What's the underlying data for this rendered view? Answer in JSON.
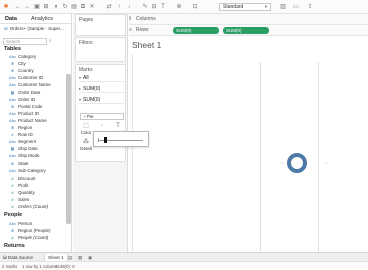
{
  "toolbar": {
    "icons": [
      "tableau-logo-icon",
      "back-icon",
      "forward-icon",
      "save-icon",
      "new-datasource-icon",
      "pause-icon",
      "refresh-icon",
      "new-sheet-icon",
      "duplicate-icon",
      "clear-icon",
      "swap-icon",
      "sort-asc-icon",
      "sort-desc-icon",
      "highlight-icon",
      "group-icon",
      "label-icon",
      "fix-axes-icon",
      "fit-icon",
      "show-cards-icon",
      "presentation-icon",
      "share-icon"
    ],
    "fit_value": "Standard"
  },
  "data_pane": {
    "tab_data": "Data",
    "tab_analytics": "Analytics",
    "datasource": "Orders+ (Sample - Super...",
    "search_placeholder": "Search",
    "tables_header": "Tables",
    "dimensions": [
      {
        "icon": "Abc",
        "label": "Category"
      },
      {
        "icon": "globe",
        "label": "City"
      },
      {
        "icon": "globe",
        "label": "Country"
      },
      {
        "icon": "Abc",
        "label": "Customer ID"
      },
      {
        "icon": "Abc",
        "label": "Customer Name"
      },
      {
        "icon": "date",
        "label": "Order Date"
      },
      {
        "icon": "Abc",
        "label": "Order ID"
      },
      {
        "icon": "globe",
        "label": "Postal Code"
      },
      {
        "icon": "Abc",
        "label": "Product ID"
      },
      {
        "icon": "Abc",
        "label": "Product Name"
      },
      {
        "icon": "globe",
        "label": "Region"
      },
      {
        "icon": "#",
        "label": "Row ID"
      },
      {
        "icon": "Abc",
        "label": "Segment"
      },
      {
        "icon": "date",
        "label": "Ship Date"
      },
      {
        "icon": "Abc",
        "label": "Ship Mode"
      },
      {
        "icon": "globe",
        "label": "State"
      },
      {
        "icon": "Abc",
        "label": "Sub-Category"
      }
    ],
    "measures": [
      {
        "icon": "#",
        "label": "Discount"
      },
      {
        "icon": "#",
        "label": "Profit"
      },
      {
        "icon": "#",
        "label": "Quantity"
      },
      {
        "icon": "#",
        "label": "Sales"
      },
      {
        "icon": "#",
        "label": "Orders (Count)"
      }
    ],
    "people_header": "People",
    "people_fields": [
      {
        "icon": "Abc",
        "label": "Person"
      },
      {
        "icon": "globe",
        "label": "Region (People)"
      },
      {
        "icon": "#",
        "label": "People (Count)"
      }
    ],
    "returns_header": "Returns"
  },
  "cards": {
    "pages_title": "Pages",
    "filters_title": "Filters",
    "marks_title": "Marks",
    "marks_pills": [
      "All",
      "SUM(0)",
      "SUM(0)"
    ],
    "mark_type": "Pie",
    "encodings": [
      {
        "icon": "color-icon",
        "label": "Color"
      },
      {
        "icon": "size-icon",
        "label": "Size"
      },
      {
        "icon": "label-icon",
        "label": "Label"
      },
      {
        "icon": "detail-icon",
        "label": "Detail"
      }
    ]
  },
  "view": {
    "columns_label": "Columns",
    "rows_label": "Rows",
    "rows_pills": [
      "SUM(0)",
      "SUM(0)"
    ],
    "sheet_title": "Sheet 1"
  },
  "bottom": {
    "datasource_tab": "Data Source",
    "sheet_tab": "Sheet 1"
  },
  "status": {
    "marks": "2 marks",
    "dims": "1 row by 1 column",
    "sum": "SUM(0): 0"
  },
  "colors": {
    "green_pill": "#2a9e64",
    "ring": "#4e79a7"
  }
}
